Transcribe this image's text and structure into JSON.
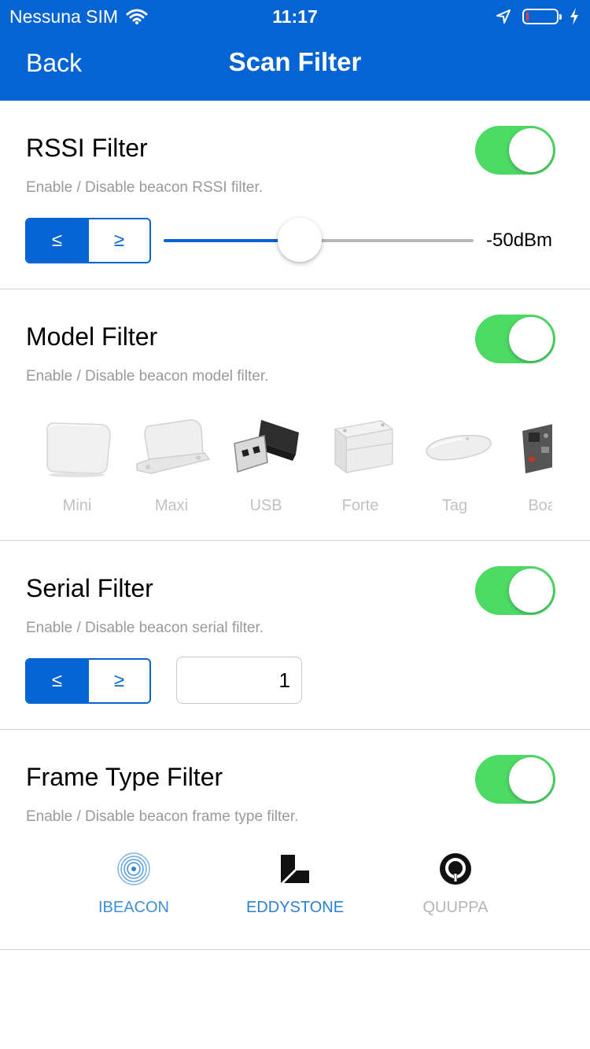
{
  "status_bar": {
    "carrier": "Nessuna SIM",
    "time": "11:17"
  },
  "nav": {
    "back_label": "Back",
    "title": "Scan Filter"
  },
  "rssi": {
    "title": "RSSI Filter",
    "subtitle": "Enable / Disable beacon RSSI filter.",
    "enabled": true,
    "op_le": "≤",
    "op_ge": "≥",
    "selected_op": "≤",
    "slider_fraction": 0.44,
    "value_label": "-50dBm"
  },
  "model": {
    "title": "Model Filter",
    "subtitle": "Enable / Disable beacon model filter.",
    "enabled": true,
    "items": [
      {
        "label": "Mini"
      },
      {
        "label": "Maxi"
      },
      {
        "label": "USB"
      },
      {
        "label": "Forte"
      },
      {
        "label": "Tag"
      },
      {
        "label": "Board"
      }
    ]
  },
  "serial": {
    "title": "Serial Filter",
    "subtitle": "Enable / Disable beacon serial filter.",
    "enabled": true,
    "op_le": "≤",
    "op_ge": "≥",
    "selected_op": "≤",
    "value": "1"
  },
  "frame": {
    "title": "Frame Type Filter",
    "subtitle": "Enable / Disable beacon frame type filter.",
    "enabled": true,
    "items": [
      {
        "label": "IBEACON",
        "selected": true
      },
      {
        "label": "EDDYSTONE",
        "selected": true
      },
      {
        "label": "QUUPPA",
        "selected": false
      }
    ]
  },
  "colors": {
    "accent": "#0564d3",
    "toggle_on": "#4cd964",
    "ibeacon": "#3d8fd6",
    "eddystone": "#2b7fd4",
    "disabled": "#b5b5b5"
  },
  "icons": [
    "wifi-icon",
    "location-arrow-icon",
    "battery-icon",
    "charging-bolt-icon",
    "ibeacon-icon",
    "eddystone-icon",
    "quuppa-icon"
  ]
}
